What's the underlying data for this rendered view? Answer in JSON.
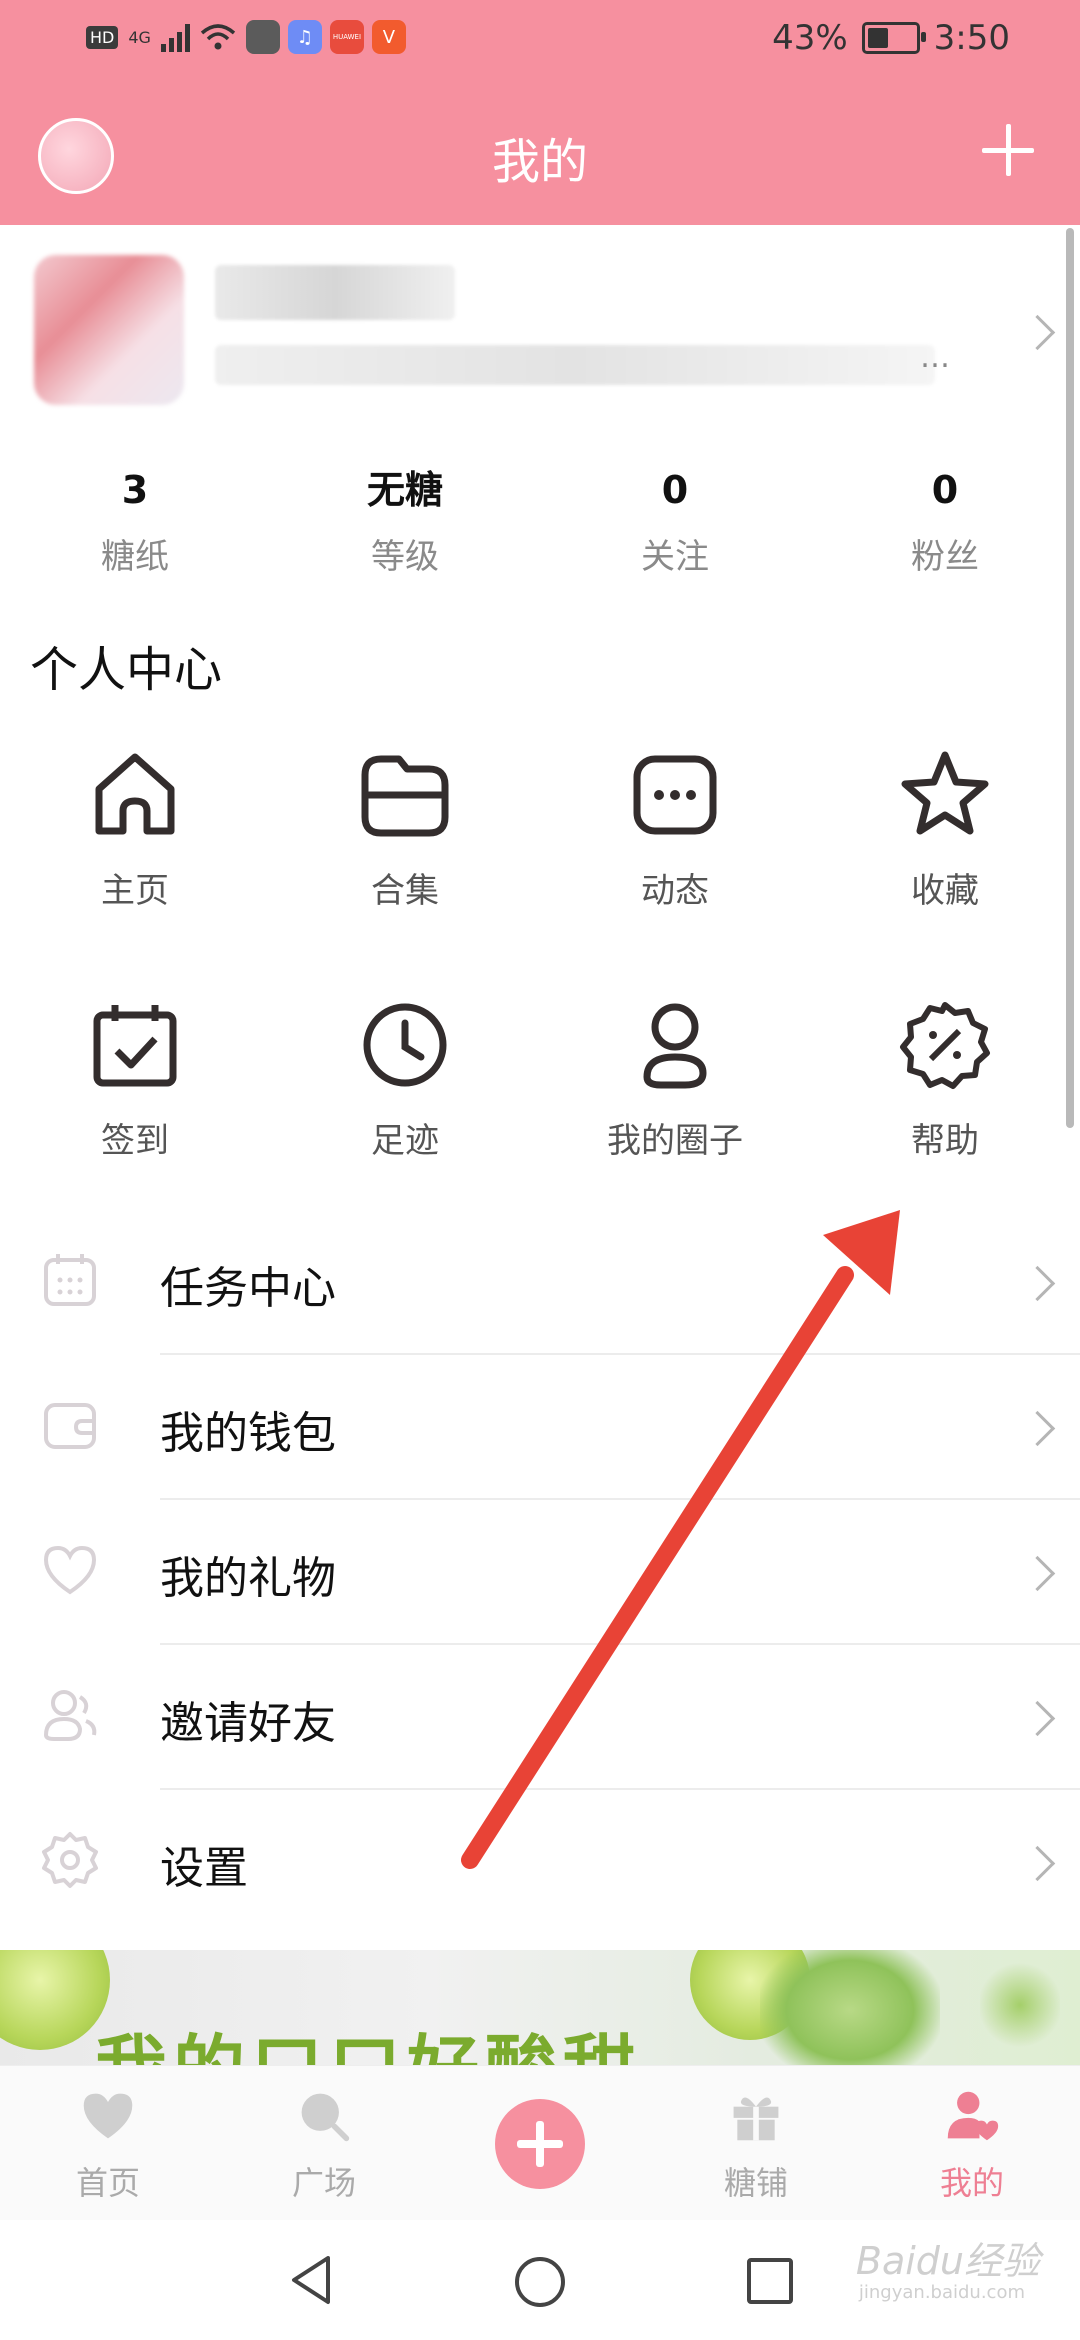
{
  "status_bar": {
    "tag": "HD",
    "network": "4G",
    "battery_percent": "43%",
    "battery_level": 0.43,
    "time": "3:50",
    "app_chips": [
      {
        "name": "app-icon-1",
        "text": "",
        "color": "#5b5b5b"
      },
      {
        "name": "app-icon-music",
        "text": "♫",
        "color": "#6e8cf5"
      },
      {
        "name": "app-icon-huawei",
        "text": "HUAWEI",
        "color": "#e84c3d"
      },
      {
        "name": "app-icon-v",
        "text": "V",
        "color": "#f25b2e"
      }
    ]
  },
  "header": {
    "title": "我的"
  },
  "profile": {
    "ellipsis": "…"
  },
  "stats": [
    {
      "value": "3",
      "label": "糖纸"
    },
    {
      "value": "无糖",
      "label": "等级"
    },
    {
      "value": "0",
      "label": "关注"
    },
    {
      "value": "0",
      "label": "粉丝"
    }
  ],
  "section": {
    "title": "个人中心"
  },
  "grid": [
    {
      "label": "主页",
      "icon": "home-icon"
    },
    {
      "label": "合集",
      "icon": "folder-icon"
    },
    {
      "label": "动态",
      "icon": "message-dots-icon"
    },
    {
      "label": "收藏",
      "icon": "star-icon"
    },
    {
      "label": "签到",
      "icon": "calendar-check-icon"
    },
    {
      "label": "足迹",
      "icon": "clock-icon"
    },
    {
      "label": "我的圈子",
      "icon": "user-circle-icon"
    },
    {
      "label": "帮助",
      "icon": "help-badge-icon"
    }
  ],
  "list": [
    {
      "label": "任务中心",
      "icon": "calendar-icon"
    },
    {
      "label": "我的钱包",
      "icon": "wallet-icon"
    },
    {
      "label": "我的礼物",
      "icon": "heart-icon"
    },
    {
      "label": "邀请好友",
      "icon": "invite-friends-icon"
    },
    {
      "label": "设置",
      "icon": "gear-icon"
    }
  ],
  "banner": {
    "text": "我的口口好酸甜"
  },
  "bottom_nav": [
    {
      "label": "首页",
      "icon": "heart-icon"
    },
    {
      "label": "广场",
      "icon": "search-icon"
    },
    {
      "label": "糖铺",
      "icon": "gift-icon"
    },
    {
      "label": "我的",
      "icon": "user-heart-icon",
      "active": true
    }
  ],
  "colors": {
    "accent": "#f6909f",
    "active_nav": "#ee7f93",
    "arrow": "#e84336"
  },
  "watermark": {
    "brand": "Baidu经验",
    "url": "jingyan.baidu.com"
  }
}
